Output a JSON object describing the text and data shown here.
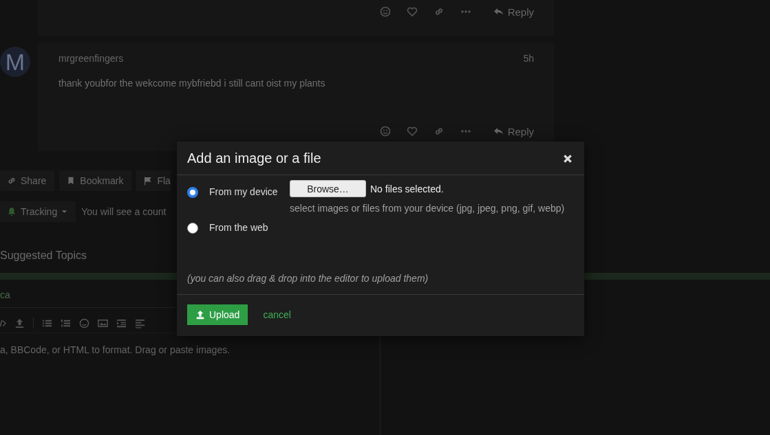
{
  "posts": [
    {
      "actions": {
        "reply": "Reply"
      }
    },
    {
      "avatar_letter": "M",
      "username": "mrgreenfingers",
      "time": "5h",
      "body": "thank youbfor the wekcome mybfriebd i still cant oist my plants",
      "actions": {
        "reply": "Reply"
      }
    }
  ],
  "topic_buttons": [
    {
      "label": "Share"
    },
    {
      "label": "Bookmark"
    },
    {
      "label": "Fla"
    }
  ],
  "notification": {
    "label": "Tracking",
    "description": "You will see a count"
  },
  "suggested_topics": {
    "heading": "Suggested Topics"
  },
  "composer": {
    "title_fragment": "ca",
    "hint": "a, BBCode, or HTML to format. Drag or paste images."
  },
  "modal": {
    "title": "Add an image or a file",
    "options": [
      {
        "label": "From my device",
        "selected": true
      },
      {
        "label": "From the web",
        "selected": false
      }
    ],
    "browse_button": "Browse…",
    "file_status": "No files selected.",
    "file_hint": "select images or files from your device (jpg, jpeg, png, gif, webp)",
    "drag_note": "(you can also drag & drop into the editor to upload them)",
    "upload_button": "Upload",
    "cancel_link": "cancel"
  }
}
